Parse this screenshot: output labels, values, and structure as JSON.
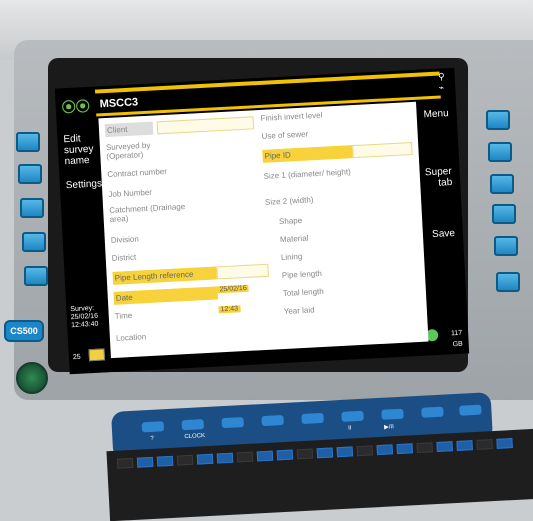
{
  "screen": {
    "title": "MSCC3",
    "left_menu": [
      "Edit survey name",
      "Settings"
    ],
    "right_menu": [
      "Menu",
      "Super tab",
      "Save"
    ],
    "survey_label": "Survey:",
    "survey_date": "25/02/16",
    "survey_time": "12:43:40",
    "bottom_left": "25",
    "bottom_right": "117 GB",
    "form_left": [
      "Client",
      "Surveyed by (Operator)",
      "Contract number",
      "Job Number",
      "Catchment (Drainage area)",
      "Division",
      "District",
      "Pipe Length reference",
      "Date",
      "Time",
      "Location"
    ],
    "form_right": [
      "Finish invert level",
      "Use of sewer",
      "Pipe ID",
      "Size 1 (diameter/ height)",
      "Size 2 (width)",
      "Shape",
      "Material",
      "Lining",
      "Pipe length",
      "Total length",
      "Year laid"
    ],
    "values": {
      "date": "25/02/16",
      "time": "12:43"
    }
  },
  "hardware": {
    "device_label": "CS500",
    "function_keys": [
      "?",
      "CLOCK",
      "",
      "",
      "",
      "II",
      "▶/II",
      "",
      ""
    ]
  }
}
